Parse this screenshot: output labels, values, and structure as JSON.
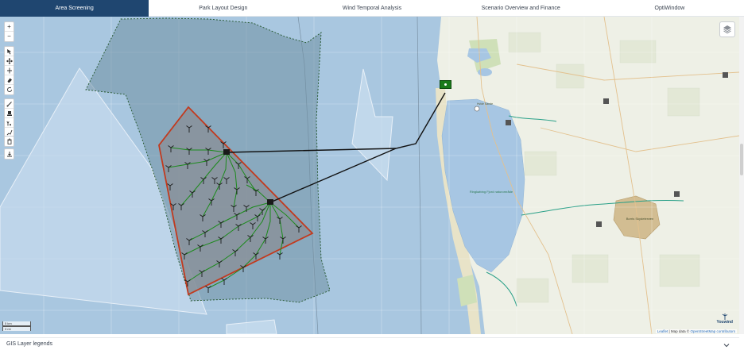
{
  "tabs": [
    {
      "label": "Area Screening",
      "active": true
    },
    {
      "label": "Park Layout Design",
      "active": false
    },
    {
      "label": "Wind Temporal Analysis",
      "active": false
    },
    {
      "label": "Scenario Overview and Finance",
      "active": false
    },
    {
      "label": "OptiWindow",
      "active": false
    }
  ],
  "toolbar": {
    "zoom_in": "+",
    "zoom_out": "−",
    "icons": [
      "edit-vertex-icon",
      "move-icon",
      "cut-icon",
      "erase-icon",
      "rotate-icon",
      "draw-line-icon",
      "substation-icon",
      "add-turbine-icon",
      "cable-icon",
      "delete-icon",
      "download-icon"
    ]
  },
  "map": {
    "scale": {
      "metric": "5 km",
      "imperial": "3 mi"
    },
    "attribution_leaflet": "Leaflet",
    "attribution_sep": " | Map data © ",
    "attribution_osm": "OpenStreetMap contributors",
    "brand": "Youwind",
    "labels": {
      "nature_park": "Ringkøbing Fjord naturområde",
      "heath": "Borris Skydeterræn",
      "town": "Hvide Sande"
    },
    "colors": {
      "sea": "#a9c7e0",
      "land": "#eef0e6",
      "fjord": "#a7c6e3",
      "boundary": "#c23a1e",
      "cables": "#1c8a1c",
      "export": "#111111",
      "site_marker": "#1a7a1a"
    }
  },
  "legend_panel": {
    "title": "GIS Layer legends",
    "chevron": "⌄"
  }
}
